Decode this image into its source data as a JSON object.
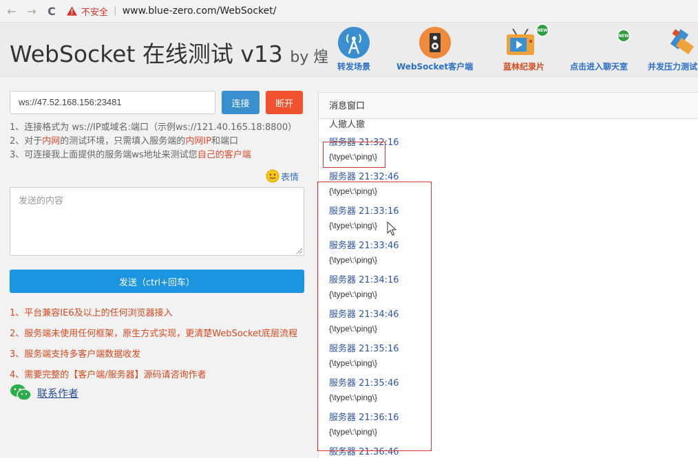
{
  "browser": {
    "back_icon": "←",
    "forward_icon": "→",
    "reload_icon": "C",
    "insecure_label": "不安全",
    "separator": "|",
    "url": "www.blue-zero.com/WebSocket/"
  },
  "header": {
    "title": "WebSocket 在线测试 v13",
    "by": "by 煌",
    "nav": [
      {
        "label": "转发场景",
        "color": "#2a70c8",
        "icon": "antenna-icon"
      },
      {
        "label": "WebSocket客户端",
        "color": "#2a70c8",
        "icon": "speaker-icon"
      },
      {
        "label": "蓝林纪录片",
        "color": "#d8481c",
        "icon": "tv-icon",
        "badge": "NEW"
      },
      {
        "label": "点击进入聊天室",
        "color": "#2a70c8",
        "icon": "chat-icon",
        "badge": "NEW"
      },
      {
        "label": "并发压力测试",
        "color": "#2a70c8",
        "icon": "satellite-icon"
      }
    ]
  },
  "connection": {
    "url_value": "ws://47.52.168.156:23481",
    "connect_label": "连接",
    "disconnect_label": "断开"
  },
  "hints": {
    "line1": "1、连接格式为 ws://IP或域名:端口（示例ws://121.40.165.18:8800）",
    "line2_a": "2、对于",
    "line2_b": "内网",
    "line2_c": "的测试环境，只需填入服务端的",
    "line2_d": "内网IP",
    "line2_e": "和端口",
    "line3_a": "3、可连接我上面提供的服务端ws地址来测试您",
    "line3_b": "自己的客户端"
  },
  "emoji_label": "表情",
  "send": {
    "placeholder": "发送的内容",
    "button_label": "发送（ctrl+回车）"
  },
  "features": [
    "1、平台兼容IE6及以上的任何浏览器接入",
    "2、服务端未使用任何框架，原生方式实现，更清楚WebSocket底层流程",
    "3、服务端支持多客户端数据收发",
    "4、需要完整的【客户端/服务器】源码请咨询作者"
  ],
  "contact_label": "联系作者",
  "messages_panel": {
    "title": "消息窗口",
    "partial_top": "人撤人撤",
    "messages": [
      {
        "sender": "服务器 21:32:16",
        "body": "{\\type\\:\\ping\\}"
      },
      {
        "sender": "服务器 21:32:46",
        "body": "{\\type\\:\\ping\\}"
      },
      {
        "sender": "服务器 21:33:16",
        "body": "{\\type\\:\\ping\\}"
      },
      {
        "sender": "服务器 21:33:46",
        "body": "{\\type\\:\\ping\\}"
      },
      {
        "sender": "服务器 21:34:16",
        "body": "{\\type\\:\\ping\\}"
      },
      {
        "sender": "服务器 21:34:46",
        "body": "{\\type\\:\\ping\\}"
      },
      {
        "sender": "服务器 21:35:16",
        "body": "{\\type\\:\\ping\\}"
      },
      {
        "sender": "服务器 21:35:46",
        "body": "{\\type\\:\\ping\\}"
      },
      {
        "sender": "服务器 21:36:16",
        "body": "{\\type\\:\\ping\\}"
      },
      {
        "sender": "服务器 21:36:46",
        "body": ""
      }
    ]
  }
}
